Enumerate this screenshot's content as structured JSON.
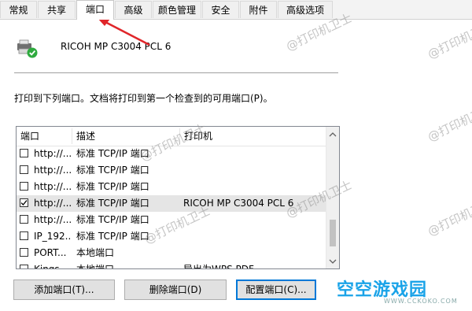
{
  "tabs": [
    "常规",
    "共享",
    "端口",
    "高级",
    "颜色管理",
    "安全",
    "附件",
    "高级选项"
  ],
  "active_tab": "端口",
  "printer_name": "RICOH MP C3004 PCL 6",
  "description": "打印到下列端口。文档将打印到第一个检查到的可用端口(P)。",
  "columns": [
    "端口",
    "描述",
    "打印机"
  ],
  "rows": [
    {
      "port": "http://...",
      "desc": "标准 TCP/IP 端口",
      "printer": "",
      "checked": false
    },
    {
      "port": "http://...",
      "desc": "标准 TCP/IP 端口",
      "printer": "",
      "checked": false
    },
    {
      "port": "http://...",
      "desc": "标准 TCP/IP 端口",
      "printer": "",
      "checked": false
    },
    {
      "port": "http://...",
      "desc": "标准 TCP/IP 端口",
      "printer": "RICOH MP C3004 PCL 6",
      "checked": true
    },
    {
      "port": "http://...",
      "desc": "标准 TCP/IP 端口",
      "printer": "",
      "checked": false
    },
    {
      "port": "IP_192....",
      "desc": "标准 TCP/IP 端口",
      "printer": "",
      "checked": false
    },
    {
      "port": "PORT...",
      "desc": "本地端口",
      "printer": "",
      "checked": false
    },
    {
      "port": "Kings...",
      "desc": "本地端口",
      "printer": "导出为WPS PDF",
      "checked": false
    }
  ],
  "buttons": {
    "add": "添加端口(T)...",
    "delete": "删除端口(D)",
    "configure": "配置端口(C)..."
  },
  "watermark": "@打印机卫士",
  "logo": {
    "title": "空空游戏园",
    "sub": "WWW.CCKOKO.COM"
  },
  "colors": {
    "accent": "#0078d7",
    "arrow": "#e0262a",
    "logo": "#1aa3e8"
  }
}
